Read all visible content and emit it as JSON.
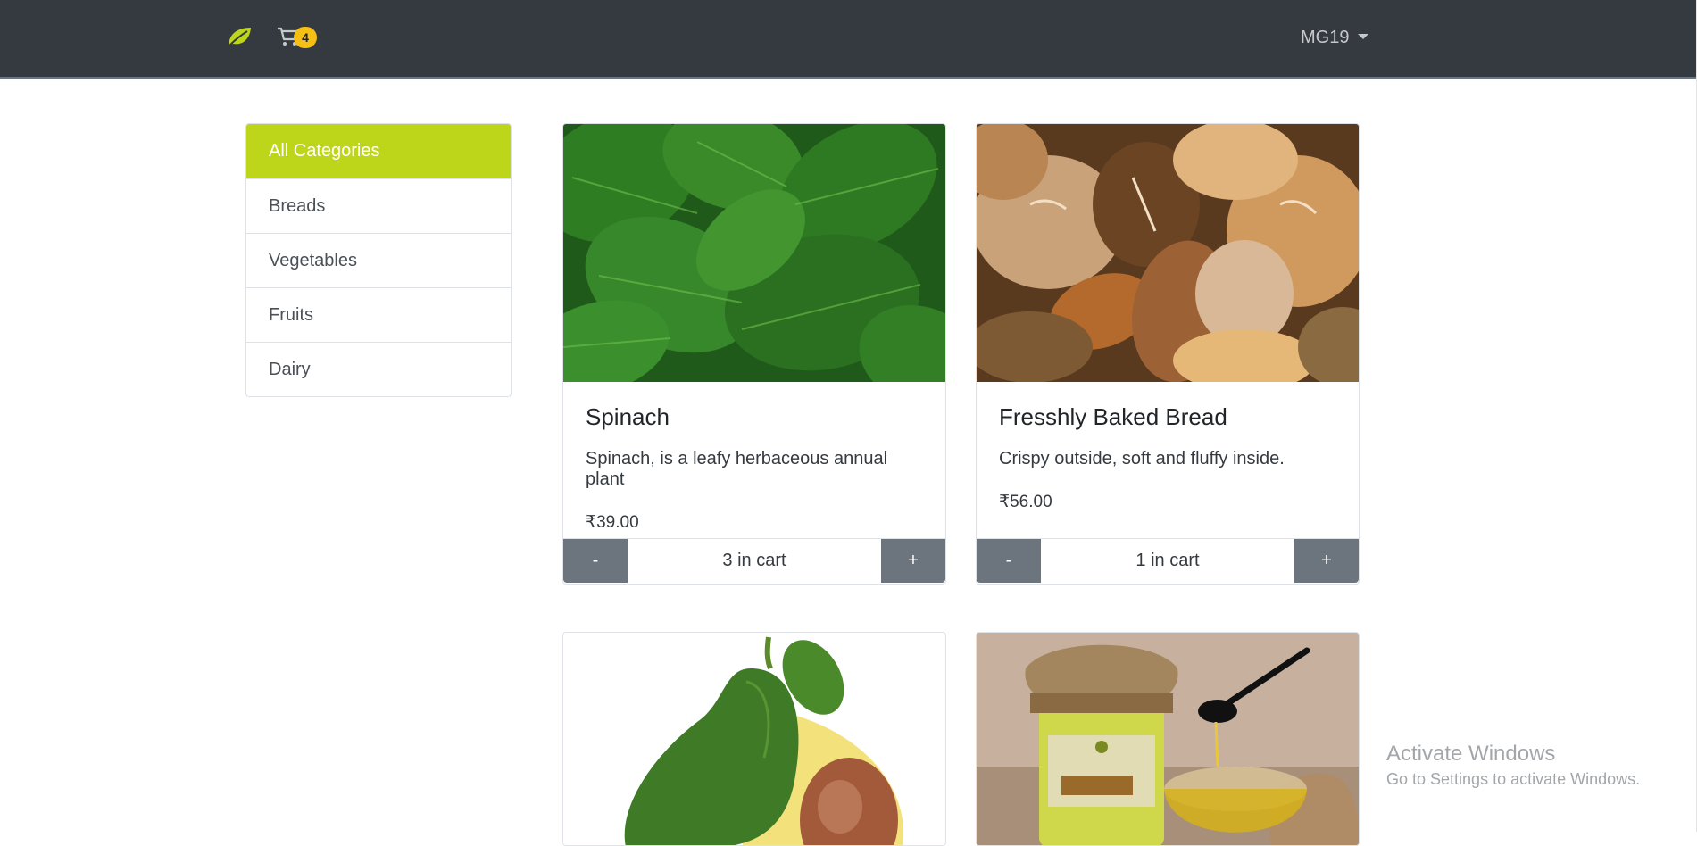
{
  "navbar": {
    "logo_icon": "leaf-icon",
    "cart_icon": "cart-icon",
    "cart_count": "4",
    "user_label": "MG19",
    "colors": {
      "background": "#343a40",
      "badge": "#f5bf16",
      "logo": "#bed61a"
    }
  },
  "sidebar": {
    "items": [
      {
        "label": "All Categories",
        "active": true
      },
      {
        "label": "Breads"
      },
      {
        "label": "Vegetables"
      },
      {
        "label": "Fruits"
      },
      {
        "label": "Dairy"
      }
    ],
    "colors": {
      "active": "#bed61a"
    }
  },
  "products": [
    {
      "image": "spinach-image",
      "title": "Spinach",
      "description": "Spinach, is a leafy herbaceous annual plant",
      "price": "₹39.00",
      "cart_text": "3 in cart",
      "minus_label": "-",
      "plus_label": "+"
    },
    {
      "image": "bread-image",
      "title": "Fresshly Baked Bread",
      "description": "Crispy outside, soft and fluffy inside.",
      "price": "₹56.00",
      "cart_text": "1 in cart",
      "minus_label": "-",
      "plus_label": "+"
    },
    {
      "image": "avocado-image"
    },
    {
      "image": "ghee-image"
    }
  ],
  "watermark": {
    "line1": "Activate Windows",
    "line2": "Go to Settings to activate Windows."
  }
}
